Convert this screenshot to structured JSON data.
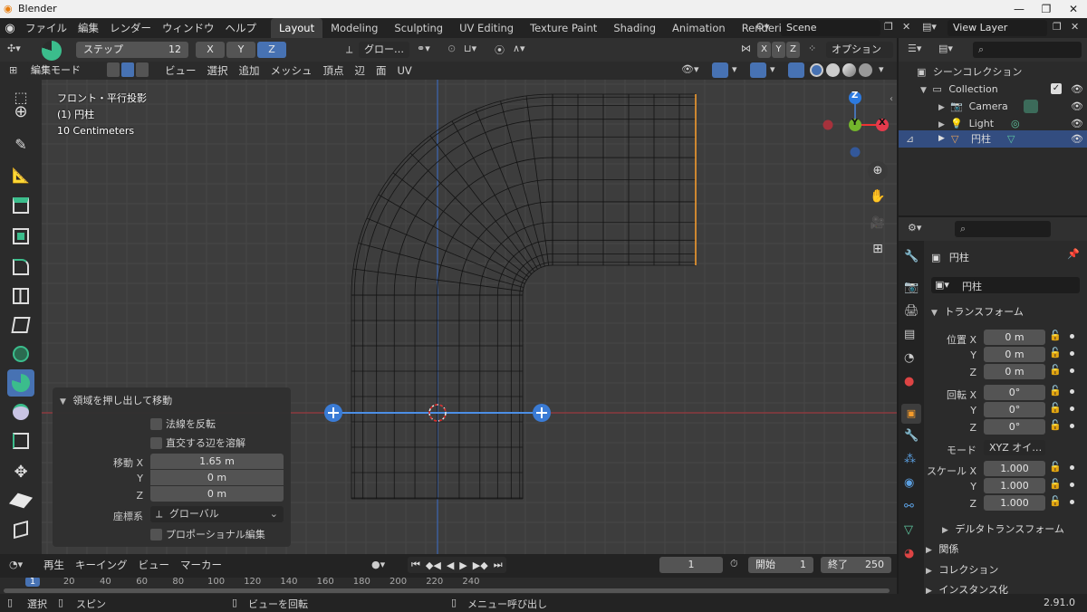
{
  "app": {
    "title": "Blender",
    "version": "2.91.0"
  },
  "menus": [
    "ファイル",
    "編集",
    "レンダー",
    "ウィンドウ",
    "ヘルプ"
  ],
  "workspaces": [
    {
      "label": "Layout",
      "active": true
    },
    {
      "label": "Modeling"
    },
    {
      "label": "Sculpting"
    },
    {
      "label": "UV Editing"
    },
    {
      "label": "Texture Paint"
    },
    {
      "label": "Shading"
    },
    {
      "label": "Animation"
    },
    {
      "label": "Rendering"
    }
  ],
  "scene": {
    "name": "Scene",
    "view_layer": "View Layer"
  },
  "tool_header": {
    "step_label": "ステップ",
    "step_value": "12",
    "axes": [
      "X",
      "Y",
      "Z"
    ],
    "active_axis": "Z",
    "orientation": "グロー…",
    "options": "オプション"
  },
  "viewport_header": {
    "mode": "編集モード",
    "menus": [
      "ビュー",
      "選択",
      "追加",
      "メッシュ",
      "頂点",
      "辺",
      "面",
      "UV"
    ]
  },
  "viewport_info": {
    "line1": "フロント・平行投影",
    "line2": "(1) 円柱",
    "line3": "10 Centimeters"
  },
  "gizmo": {
    "z": "Z",
    "y": "Y",
    "x": "X"
  },
  "operator_panel": {
    "title": "領域を押し出して移動",
    "flip_normals": "法線を反転",
    "dissolve": "直交する辺を溶解",
    "move_label": "移動 X",
    "move_x": "1.65 m",
    "y_label": "Y",
    "move_y": "0 m",
    "z_label": "Z",
    "move_z": "0 m",
    "orient_label": "座標系",
    "orient_value": "グローバル",
    "proportional": "プロポーショナル編集"
  },
  "outliner": {
    "root": "シーンコレクション",
    "collection": "Collection",
    "items": [
      "Camera",
      "Light",
      "円柱"
    ]
  },
  "properties": {
    "object_name": "円柱",
    "data_name": "円柱",
    "transform_title": "トランスフォーム",
    "location_label": "位置 X",
    "location": [
      "0 m",
      "0 m",
      "0 m"
    ],
    "rotation_label": "回転 X",
    "rotation": [
      "0°",
      "0°",
      "0°"
    ],
    "mode_label": "モード",
    "mode_value": "XYZ オイ…",
    "scale_label": "スケール X",
    "scale": [
      "1.000",
      "1.000",
      "1.000"
    ],
    "y": "Y",
    "z": "Z",
    "delta": "デルタトランスフォーム",
    "sections": [
      "関係",
      "コレクション",
      "インスタンス化"
    ]
  },
  "timeline": {
    "menus": [
      "再生",
      "キーイング",
      "ビュー",
      "マーカー"
    ],
    "current_frame": "1",
    "start_label": "開始",
    "start": "1",
    "end_label": "終了",
    "end": "250",
    "ruler": [
      "1",
      "20",
      "40",
      "60",
      "80",
      "100",
      "120",
      "140",
      "160",
      "180",
      "200",
      "220",
      "240"
    ]
  },
  "statusbar": {
    "select": "選択",
    "spin": "スピン",
    "rotate_view": "ビューを回転",
    "menu": "メニュー呼び出し"
  }
}
